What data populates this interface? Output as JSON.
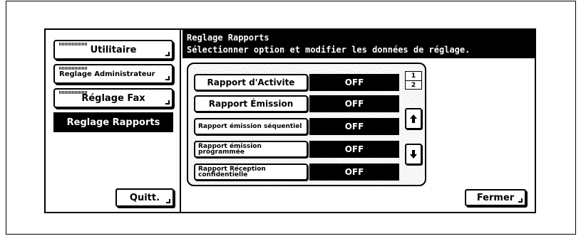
{
  "sidebar": {
    "items": [
      {
        "label": "Utilitaire"
      },
      {
        "label": "Reglage Administrateur"
      },
      {
        "label": "Réglage Fax"
      },
      {
        "label": "Reglage Rapports",
        "active": true
      }
    ],
    "quit_label": "Quitt."
  },
  "header": {
    "title": "Reglage Rapports",
    "subtitle": "Sélectionner option et modifier les données de réglage."
  },
  "options": [
    {
      "label": "Rapport d'Activite",
      "value": "OFF"
    },
    {
      "label": "Rapport Émission",
      "value": "OFF"
    },
    {
      "label": "Rapport émission séquentiel",
      "value": "OFF"
    },
    {
      "label": "Rapport émission programmée",
      "value": "OFF"
    },
    {
      "label": "Rapport Réception confidentielle",
      "value": "OFF"
    }
  ],
  "pager": {
    "current": "1",
    "total": "2"
  },
  "icons": {
    "up": "arrow-up-icon",
    "down": "arrow-down-icon"
  },
  "close_label": "Fermer"
}
